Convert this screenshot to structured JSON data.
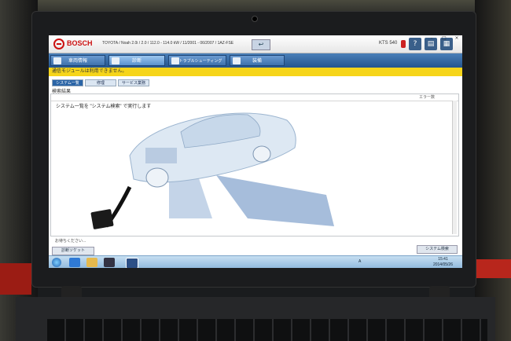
{
  "app": {
    "brand": "BOSCH",
    "vehicle_info": "TOYOTA / Noah 2.0i / 2.0 / 112.0 - 114.0 kW / 11/2001 - 06/2007 / 1AZ-FSE",
    "tester": "KTS 540",
    "colors": {
      "nav_blue": "#2a64a6",
      "status_yellow": "#f6d51a",
      "brand_red": "#cc1111"
    }
  },
  "nav": {
    "tabs": [
      {
        "label": "車両情報",
        "icon": "car-info-icon"
      },
      {
        "label": "診断",
        "icon": "diagnosis-icon"
      },
      {
        "label": "トラブルシューティング",
        "icon": "warning-icon"
      },
      {
        "label": "装備",
        "icon": "book-icon"
      }
    ]
  },
  "status_message": "通信モジュールは利用できません。",
  "subtabs": [
    "システム一覧",
    "修理",
    "サービス業務"
  ],
  "results": {
    "title": "検索結果",
    "column_errors": "エラー数",
    "instruction": "システム一覧を \"システム検索\" で実行します"
  },
  "footer": {
    "wait_text": "お待ちください...",
    "socket_button": "診断ソケット",
    "system_search_button": "システム検索"
  },
  "taskbar": {
    "ime": "A",
    "time": "15:41",
    "date": "2014/05/26"
  }
}
